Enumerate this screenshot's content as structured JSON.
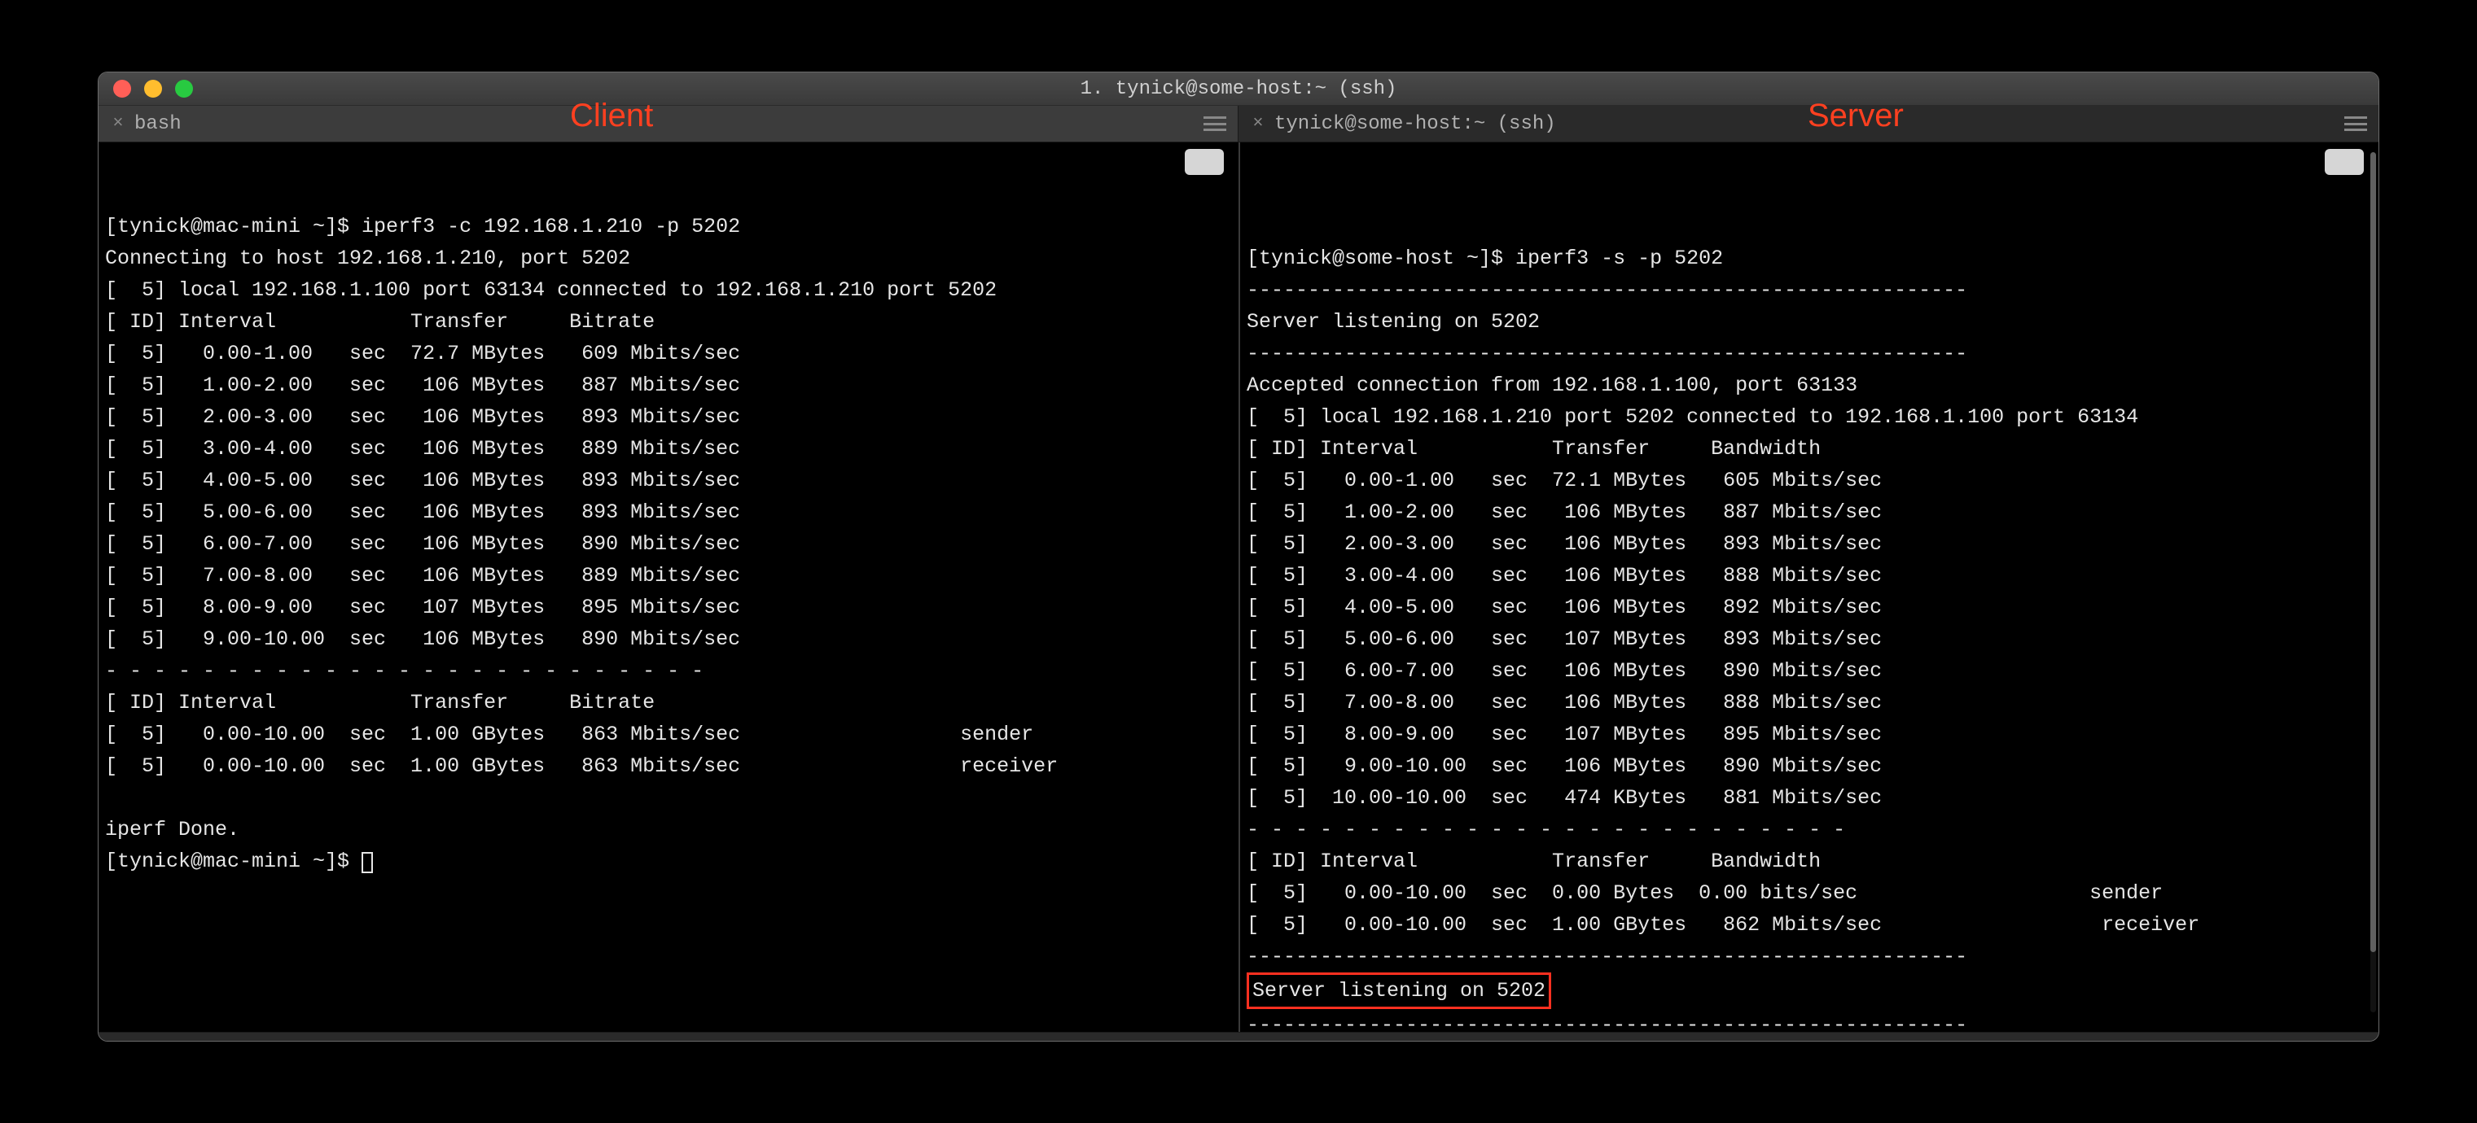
{
  "window": {
    "title": "1. tynick@some-host:~ (ssh)"
  },
  "tabs": {
    "left": "bash",
    "right": "tynick@some-host:~ (ssh)"
  },
  "labels": {
    "client": "Client",
    "server": "Server"
  },
  "client": {
    "prompt1": "[tynick@mac-mini ~]$ iperf3 -c 192.168.1.210 -p 5202",
    "connecting": "Connecting to host 192.168.1.210, port 5202",
    "local": "[  5] local 192.168.1.100 port 63134 connected to 192.168.1.210 port 5202",
    "header": "[ ID] Interval           Transfer     Bitrate",
    "rows": [
      "[  5]   0.00-1.00   sec  72.7 MBytes   609 Mbits/sec",
      "[  5]   1.00-2.00   sec   106 MBytes   887 Mbits/sec",
      "[  5]   2.00-3.00   sec   106 MBytes   893 Mbits/sec",
      "[  5]   3.00-4.00   sec   106 MBytes   889 Mbits/sec",
      "[  5]   4.00-5.00   sec   106 MBytes   893 Mbits/sec",
      "[  5]   5.00-6.00   sec   106 MBytes   893 Mbits/sec",
      "[  5]   6.00-7.00   sec   106 MBytes   890 Mbits/sec",
      "[  5]   7.00-8.00   sec   106 MBytes   889 Mbits/sec",
      "[  5]   8.00-9.00   sec   107 MBytes   895 Mbits/sec",
      "[  5]   9.00-10.00  sec   106 MBytes   890 Mbits/sec"
    ],
    "dashes": "- - - - - - - - - - - - - - - - - - - - - - - - -",
    "sum_header": "[ ID] Interval           Transfer     Bitrate",
    "sum_sender": "[  5]   0.00-10.00  sec  1.00 GBytes   863 Mbits/sec                  sender",
    "sum_receiver": "[  5]   0.00-10.00  sec  1.00 GBytes   863 Mbits/sec                  receiver",
    "done": "iperf Done.",
    "prompt2": "[tynick@mac-mini ~]$ "
  },
  "server": {
    "prompt": "[tynick@some-host ~]$ iperf3 -s -p 5202",
    "dashrule": "-----------------------------------------------------------",
    "listening": "Server listening on 5202",
    "accepted": "Accepted connection from 192.168.1.100, port 63133",
    "local": "[  5] local 192.168.1.210 port 5202 connected to 192.168.1.100 port 63134",
    "header": "[ ID] Interval           Transfer     Bandwidth",
    "rows": [
      "[  5]   0.00-1.00   sec  72.1 MBytes   605 Mbits/sec",
      "[  5]   1.00-2.00   sec   106 MBytes   887 Mbits/sec",
      "[  5]   2.00-3.00   sec   106 MBytes   893 Mbits/sec",
      "[  5]   3.00-4.00   sec   106 MBytes   888 Mbits/sec",
      "[  5]   4.00-5.00   sec   106 MBytes   892 Mbits/sec",
      "[  5]   5.00-6.00   sec   107 MBytes   893 Mbits/sec",
      "[  5]   6.00-7.00   sec   106 MBytes   890 Mbits/sec",
      "[  5]   7.00-8.00   sec   106 MBytes   888 Mbits/sec",
      "[  5]   8.00-9.00   sec   107 MBytes   895 Mbits/sec",
      "[  5]   9.00-10.00  sec   106 MBytes   890 Mbits/sec",
      "[  5]  10.00-10.00  sec   474 KBytes   881 Mbits/sec"
    ],
    "dashes": "- - - - - - - - - - - - - - - - - - - - - - - - -",
    "sum_header": "[ ID] Interval           Transfer     Bandwidth",
    "sum_sender": "[  5]   0.00-10.00  sec  0.00 Bytes  0.00 bits/sec                   sender",
    "sum_receiver": "[  5]   0.00-10.00  sec  1.00 GBytes   862 Mbits/sec                  receiver",
    "listening2": "Server listening on 5202"
  }
}
